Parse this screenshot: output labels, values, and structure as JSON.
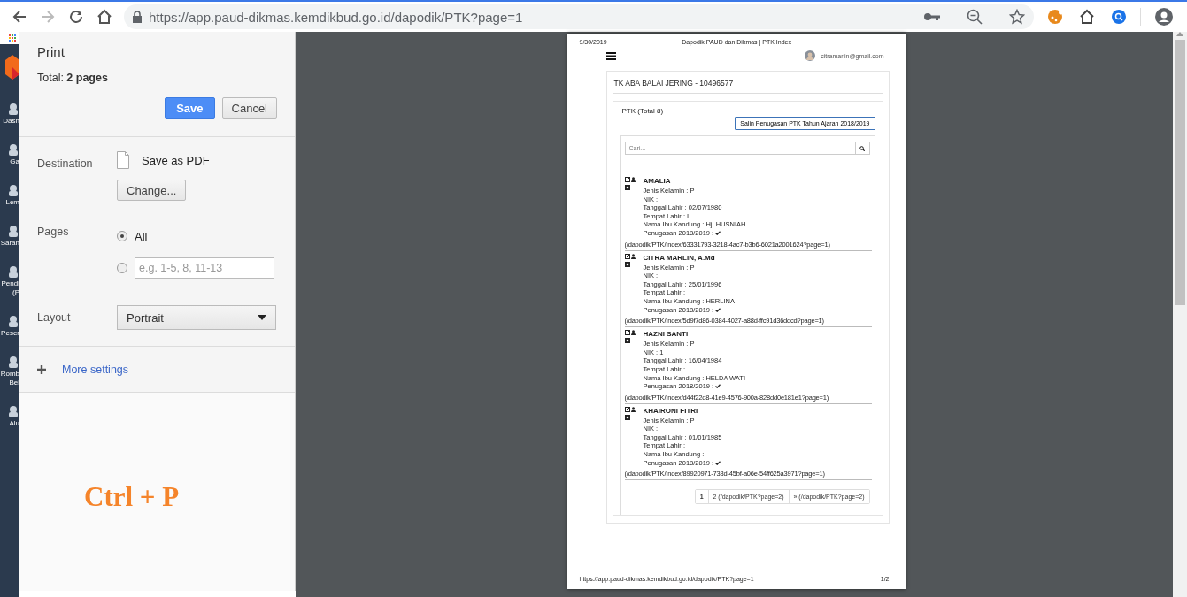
{
  "browser": {
    "back": {
      "disabled": false
    },
    "forward": {
      "disabled": true
    },
    "url": "https://app.paud-dikmas.kemdikbud.go.id/dapodik/PTK?page=1"
  },
  "background_sidebar": {
    "items": [
      {
        "lines": [
          "Dash"
        ]
      },
      {
        "lines": [
          "Ga"
        ]
      },
      {
        "lines": [
          "Lem"
        ]
      },
      {
        "lines": [
          "Saran"
        ]
      },
      {
        "lines": [
          "Pendi",
          "(P"
        ]
      },
      {
        "lines": [
          "Peser"
        ]
      },
      {
        "lines": [
          "Romb",
          "Bel"
        ]
      },
      {
        "lines": [
          "Alu"
        ]
      }
    ]
  },
  "print_dialog": {
    "title": "Print",
    "total": "Total: **2 pages**",
    "buttons": [
      {
        "label": "Save",
        "kind": "primary"
      },
      {
        "label": "Cancel",
        "kind": "secondary"
      }
    ],
    "destination": {
      "label": "Destination",
      "value": "Save as PDF",
      "change_button": "Change..."
    },
    "pages": {
      "label": "Pages",
      "options": [
        {
          "kind": "label",
          "label": "All",
          "selected": true
        },
        {
          "kind": "range",
          "placeholder": "e.g. 1-5, 8, 11-13",
          "selected": false
        }
      ]
    },
    "layout": {
      "label": "Layout",
      "value": "Portrait"
    },
    "more_settings": "More settings",
    "annotation": "Ctrl + P"
  },
  "preview": {
    "date": "9/30/2019",
    "doc_title": "Dapodik PAUD dan Dikmas | PTK Index",
    "user_email": "citramarlin@gmail.com",
    "school": "TK ABA BALAI JERING - 10496577",
    "panel_title": "PTK (Total 8)",
    "copy_button": "Salin Penugasan PTK Tahun Ajaran 2018/2019",
    "search_placeholder": "Cari...",
    "entries": [
      {
        "name": "AMALIA",
        "fields": [
          "Jenis Kelamin : P",
          "NIK :",
          "Tanggal Lahir : 02/07/1980",
          "Tempat Lahir : I",
          "Nama Ibu Kandung : Hj. HUSNIAH"
        ],
        "assignment": {
          "label": "Penugasan 2018/2019 :",
          "checked": true
        },
        "link": "(/dapodik/PTK/Index/63331793-3218-4ac7-b3b6-6021a2001624?page=1)"
      },
      {
        "name": "CITRA MARLIN, A.Md",
        "fields": [
          "Jenis Kelamin : P",
          "NIK :",
          "Tanggal Lahir : 25/01/1996",
          "Tempat Lahir :",
          "Nama Ibu Kandung : HERLINA"
        ],
        "assignment": {
          "label": "Penugasan 2018/2019 :",
          "checked": true
        },
        "link": "(/dapodik/PTK/Index/5d9f7d86-0384-4027-a88d-ffc91d36ddcd?page=1)"
      },
      {
        "name": "HAZNI SANTI",
        "fields": [
          "Jenis Kelamin : P",
          "NIK : 1",
          "Tanggal Lahir : 16/04/1984",
          "Tempat Lahir :",
          "Nama Ibu Kandung : HELDA WATI"
        ],
        "assignment": {
          "label": "Penugasan 2018/2019 :",
          "checked": true
        },
        "link": "(/dapodik/PTK/Index/d44f22d8-41e9-4576-900a-828dd0e181e1?page=1)"
      },
      {
        "name": "KHAIRONI FITRI",
        "fields": [
          "Jenis Kelamin : P",
          "NIK :",
          "Tanggal Lahir : 01/01/1985",
          "Tempat Lahir :",
          "Nama Ibu Kandung :"
        ],
        "assignment": {
          "label": "Penugasan 2018/2019 :",
          "checked": true
        },
        "link": "(/dapodik/PTK/Index/89920971-738d-45bf-a06e-54ff625a3971?page=1)"
      }
    ],
    "pagination": [
      {
        "label": "1",
        "selected": true
      },
      {
        "label": "2 (/dapodik/PTK?page=2)",
        "selected": false
      },
      {
        "label": "» (/dapodik/PTK?page=2)",
        "selected": false
      }
    ],
    "footer_url": "https://app.paud-dikmas.kemdikbud.go.id/dapodik/PTK?page=1",
    "page_number": "1/2"
  }
}
